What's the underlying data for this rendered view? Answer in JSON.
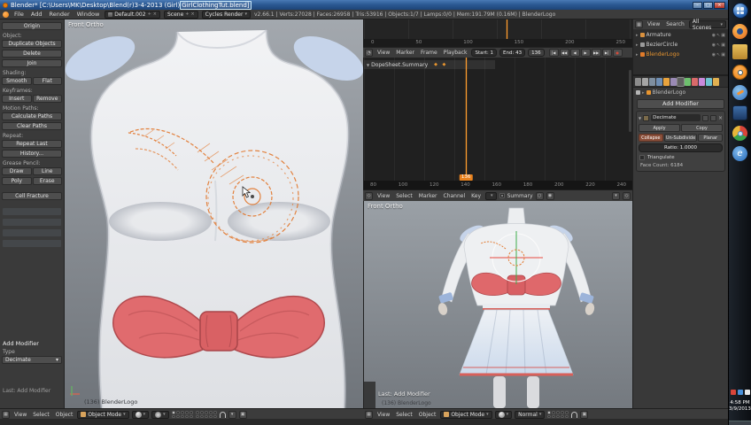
{
  "titlebar": {
    "title_prefix": "Blender* [C:\\Users\\MK\\Desktop\\Blend(r)3-4-2013 (Girl)",
    "title_highlight": "GirlClothingTut.blend]",
    "minimize": "–",
    "maximize": "□",
    "close": "×"
  },
  "infobar": {
    "menus": [
      "File",
      "Add",
      "Render",
      "Window"
    ],
    "layout": "Default.002",
    "scene": "Scene",
    "engine": "Cycles Render",
    "stats": "v2.66.1 | Verts:27028 | Faces:26958 | Tris:53916 | Objects:1/7 | Lamps:0/0 | Mem:191.79M (0.16M) | BlenderLogo"
  },
  "toolshelf": {
    "origin": "Origin",
    "object_label": "Object:",
    "duplicate": "Duplicate Objects",
    "delete": "Delete",
    "join": "Join",
    "shading_label": "Shading:",
    "smooth": "Smooth",
    "flat": "Flat",
    "keyframes_label": "Keyframes:",
    "insert": "Insert",
    "remove": "Remove",
    "motion_label": "Motion Paths:",
    "calculate": "Calculate Paths",
    "clear": "Clear Paths",
    "repeat_label": "Repeat:",
    "repeat_last": "Repeat Last",
    "history": "History...",
    "grease_label": "Grease Pencil:",
    "draw": "Draw",
    "line": "Line",
    "poly": "Poly",
    "erase": "Erase",
    "cell_fracture": "Cell Fracture",
    "redo_title": "Add Modifier",
    "type_label": "Type",
    "type_value": "Decimate",
    "last_op": "Last: Add Modifier"
  },
  "viewport_main": {
    "label": "Front Ortho",
    "info": "(136) BlenderLogo"
  },
  "timeline": {
    "ticks": [
      "0",
      "50",
      "100",
      "150",
      "200",
      "250"
    ],
    "menus": [
      "View",
      "Marker",
      "Frame",
      "Playback"
    ],
    "start": "Start: 1",
    "end": "End: 43",
    "frame": "136",
    "playback": [
      "|◀",
      "◀◀",
      "◀",
      "▶",
      "▶▶",
      "▶|"
    ]
  },
  "dopesheet": {
    "channel": "DopeSheet.Summary",
    "keys": "◆ ◆",
    "ticks": [
      "80",
      "100",
      "120",
      "140",
      "160",
      "180",
      "200",
      "220",
      "240"
    ],
    "marker": "136",
    "menus": [
      "View",
      "Select",
      "Marker",
      "Channel",
      "Key"
    ],
    "mode": "DopeSheet",
    "summary": "Summary"
  },
  "viewport_second": {
    "label": "Front Ortho",
    "last_op": "Last: Add Modifier",
    "info": "(136) BlenderLogo"
  },
  "outliner": {
    "view": "View",
    "search": "Search",
    "scenes": "All Scenes",
    "items": [
      {
        "label": "Armature"
      },
      {
        "label": "BezierCircle"
      },
      {
        "label": "BlenderLogo"
      }
    ]
  },
  "properties": {
    "breadcrumb": "BlenderLogo",
    "add_modifier": "Add Modifier",
    "modifier_name": "Decimate",
    "apply": "Apply",
    "copy": "Copy",
    "collapse": "Collapse",
    "unsubdivide": "Un-Subdivide",
    "planar": "Planar",
    "ratio": "Ratio: 1.0000",
    "triangulate": "Triangulate",
    "face_count": "Face Count: 6184"
  },
  "bottombar": {
    "left_menus": [
      "View",
      "Select",
      "Object"
    ],
    "left_mode": "Object Mode",
    "right_menus": [
      "View",
      "Select",
      "Object"
    ],
    "right_mode": "Object Mode",
    "orientation": "Normal"
  },
  "taskbar": {
    "time": "4:58 PM",
    "date": "3/9/2013",
    "ie_glyph": "e"
  },
  "icons": {
    "dropdown": "▾",
    "expand": "▸",
    "collapse": "▼",
    "close": "×",
    "plus": "+",
    "check": "✓",
    "eye": "◉",
    "cursor": "↖",
    "camera": "▣",
    "grid": "▦",
    "clock": "◔",
    "key": "◇",
    "ghost": "○",
    "record": "●"
  },
  "colors": {
    "accent_orange": "#e87d0d",
    "bow_red": "#e06b6e",
    "skirt_blue": "#ccdaec"
  }
}
